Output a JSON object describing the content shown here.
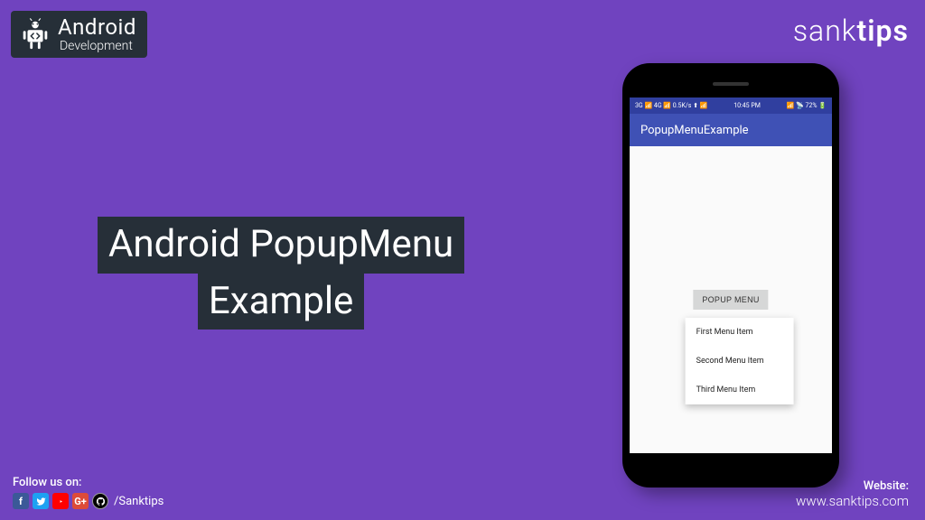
{
  "logo": {
    "main": "Android",
    "sub": "Development"
  },
  "brand": {
    "prefix": "sank",
    "suffix": "tips"
  },
  "title": {
    "line1": "Android PopupMenu",
    "line2": "Example"
  },
  "phone": {
    "statusbar": {
      "left": "3G 📶 4G 📶 0.5K/s ⬆ 📶",
      "time": "10:45 PM",
      "right": "📶 📡 72% 🔋"
    },
    "appbar_title": "PopupMenuExample",
    "popup_button": "POPUP MENU",
    "menu_items": [
      "First Menu Item",
      "Second Menu Item",
      "Third Menu Item"
    ]
  },
  "social": {
    "label": "Follow us on:",
    "handle": "/Sanktips"
  },
  "website": {
    "label": "Website:",
    "url": "www.sanktips.com"
  }
}
